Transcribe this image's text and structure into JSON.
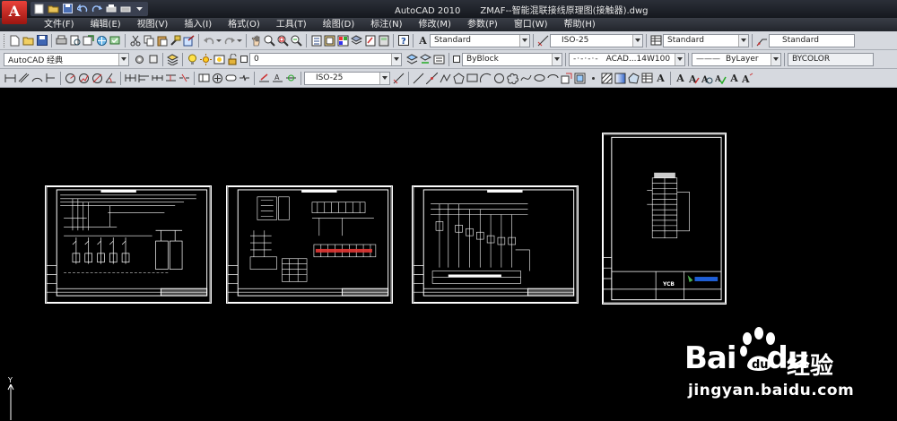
{
  "app": {
    "logo": "A",
    "name": "AutoCAD 2010",
    "file": "ZMAF--智能混联接线原理图(接触器).dwg"
  },
  "menu": [
    "文件(F)",
    "编辑(E)",
    "视图(V)",
    "插入(I)",
    "格式(O)",
    "工具(T)",
    "绘图(D)",
    "标注(N)",
    "修改(M)",
    "参数(P)",
    "窗口(W)",
    "帮助(H)"
  ],
  "toolbar1": {
    "text_style": "Standard",
    "dim_style": "ISO-25",
    "table_style": "Standard",
    "mleader_style": "Standard"
  },
  "toolbar2": {
    "workspace": "AutoCAD 经典",
    "layer": "0",
    "color": "ByBlock",
    "linetype": "ACAD...14W100",
    "lineweight": "ByLayer",
    "plot_style": "BYCOLOR"
  },
  "toolbar3": {
    "dim_style": "ISO-25"
  },
  "canvas": {
    "ucs_label": "Y"
  },
  "sheets": [
    {
      "title_badge": ""
    },
    {
      "title_badge": ""
    },
    {
      "title_badge": ""
    },
    {
      "title_badge": "YCB"
    }
  ],
  "watermark": {
    "brand_left": "Bai",
    "brand_right": "du",
    "brand_cn": "经验",
    "url": "jingyan.baidu.com"
  },
  "colors": {
    "canvas_bg": "#000000",
    "toolbar_bg": "#d6d9df",
    "menubar_bg": "#2c3038",
    "drawing_lines": "#ffffff",
    "accent_red": "#e53935",
    "accent_blue": "#1f5fd6"
  }
}
